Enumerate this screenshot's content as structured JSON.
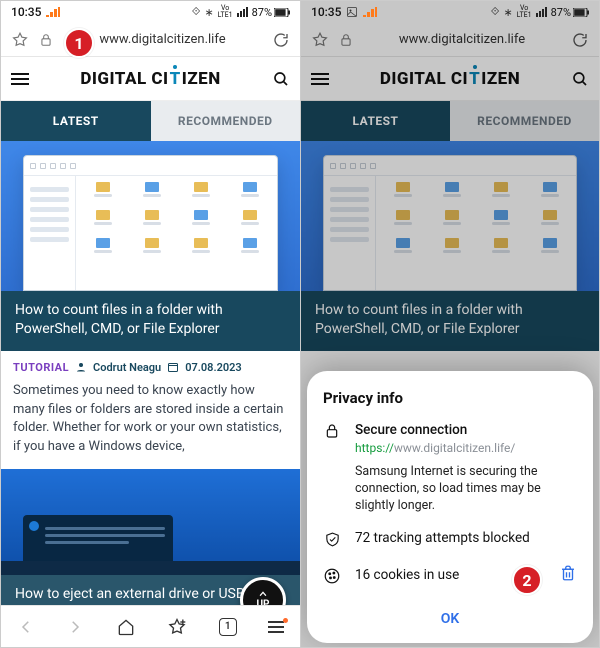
{
  "status": {
    "time": "10:35",
    "network_label": "LTE1",
    "volte_label": "Vo",
    "battery_pct": "87%"
  },
  "browser": {
    "url_display": "www.digitalcitizen.life",
    "brand_left": "DIGITAL CI",
    "brand_t": "T",
    "brand_right": "IZEN"
  },
  "tabs": {
    "latest": "LATEST",
    "recommended": "RECOMMENDED"
  },
  "article1": {
    "title": "How to count files in a folder with PowerShell, CMD, or File Explorer",
    "tag": "TUTORIAL",
    "author": "Codrut Neagu",
    "date": "07.08.2023",
    "excerpt": "Sometimes you need to know exactly how many files or folders are stored inside a certain folder. Whether for work or your own statistics, if you have a Windows device,"
  },
  "article2": {
    "title": "How to eject an external drive or USB stick from Windows"
  },
  "up_label": "UP",
  "bottomnav": {
    "tab_count": "1"
  },
  "privacy": {
    "heading": "Privacy info",
    "secure_title": "Secure connection",
    "url_https": "https://",
    "url_rest": "www.digitalcitizen.life/",
    "secure_desc": "Samsung Internet is securing the connection, so load times may be slightly longer.",
    "tracking": "72 tracking attempts blocked",
    "cookies": "16 cookies in use",
    "ok": "OK"
  },
  "callouts": {
    "one": "1",
    "two": "2"
  }
}
